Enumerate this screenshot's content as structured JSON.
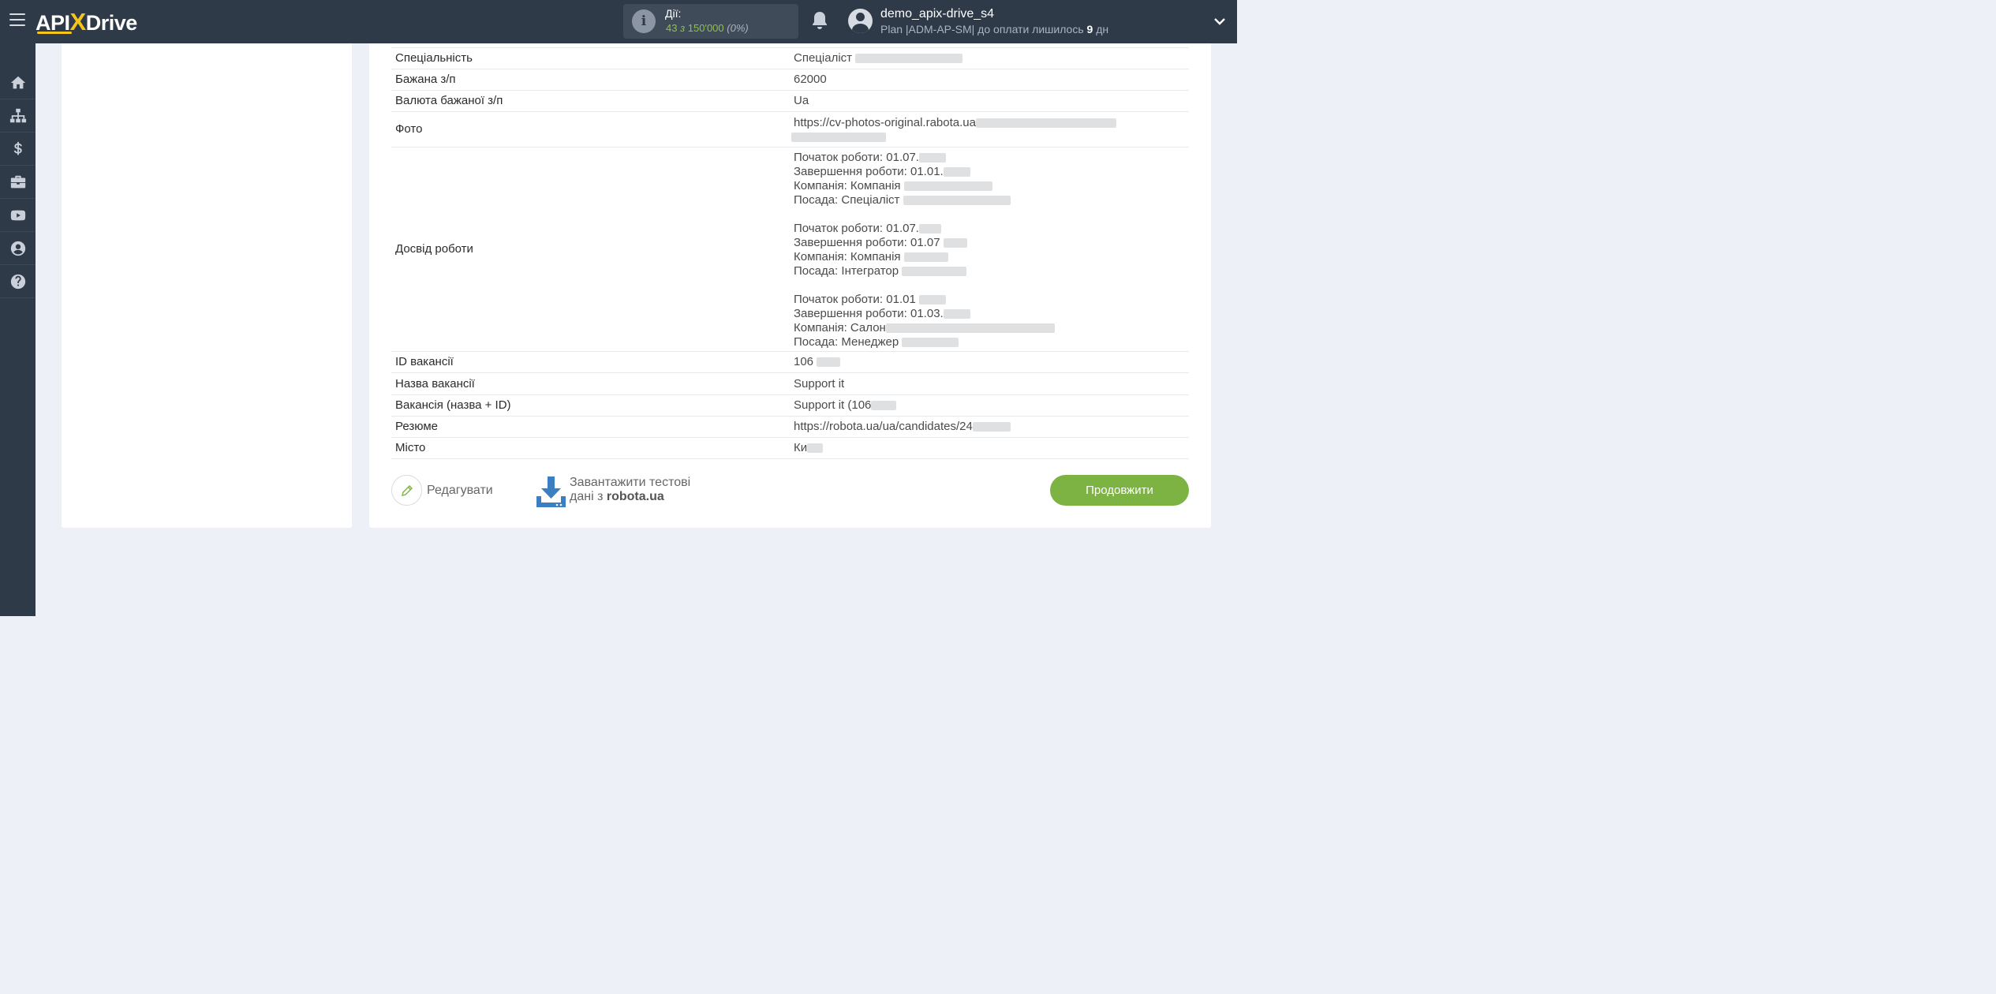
{
  "header": {
    "logo_api": "API",
    "logo_x": "X",
    "logo_drive": "Drive",
    "actions_label": "Дії:",
    "actions_used": "43",
    "actions_of": "з",
    "actions_total": "150'000",
    "actions_percent": "(0%)",
    "user_name": "demo_apix-drive_s4",
    "plan_prefix": "Plan |ADM-AP-SM| до оплати лишилось",
    "plan_days": "9",
    "plan_suffix": "дн"
  },
  "sidebar": {
    "items": [
      "home-icon",
      "sitemap-icon",
      "dollar-icon",
      "briefcase-icon",
      "youtube-icon",
      "user-icon",
      "help-icon"
    ]
  },
  "table": {
    "rows": [
      {
        "key": "Спеціальність",
        "value": "Спеціаліст"
      },
      {
        "key": "Бажана з/п",
        "value": "62000"
      },
      {
        "key": "Валюта бажаної з/п",
        "value": "Ua"
      },
      {
        "key": "Фото",
        "value": "https://cv-photos-original.rabota.ua"
      },
      {
        "key": "Досвід роботи",
        "lines": [
          "Початок роботи: 01.07.",
          "Завершення роботи: 01.01.",
          "Компанія: Компанія",
          "Посада: Спеціаліст",
          "",
          "Початок роботи: 01.07.",
          "Завершення роботи: 01.07",
          "Компанія: Компанія",
          "Посада: Інтегратор",
          "",
          "Початок роботи: 01.01",
          "Завершення роботи: 01.03.",
          "Компанія: Салон",
          "Посада: Менеджер"
        ]
      },
      {
        "key": "ID вакансії",
        "value": "106"
      },
      {
        "key": "Назва вакансії",
        "value": "Support it"
      },
      {
        "key": "Вакансія (назва + ID)",
        "value": "Support it (106"
      },
      {
        "key": "Резюме",
        "value": "https://robota.ua/ua/candidates/24"
      },
      {
        "key": "Місто",
        "value": "Ки"
      }
    ]
  },
  "footer": {
    "edit_label": "Редагувати",
    "download_line1": "Завантажити тестові",
    "download_line2_prefix": "дані з",
    "download_source": "robota.ua",
    "continue_label": "Продовжити"
  },
  "colors": {
    "topbar": "#2f3a48",
    "accent_green": "#7cb342",
    "logo_yellow": "#f5c518"
  }
}
